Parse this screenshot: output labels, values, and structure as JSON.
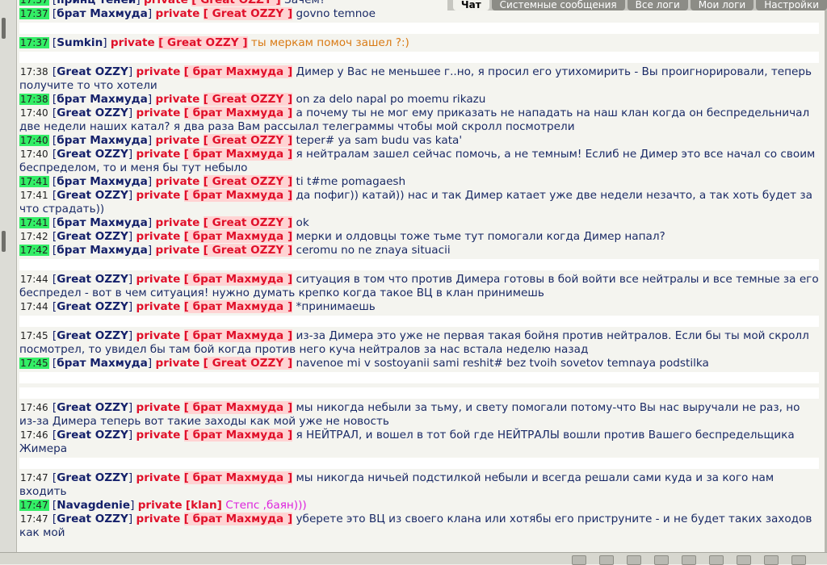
{
  "tabs": [
    "Чат",
    "Системные сообщения",
    "Все логи",
    "Мои логи",
    "Настройки"
  ],
  "messages": [
    {
      "time": "17:37",
      "time_hl": true,
      "name": "принц теней",
      "target": "Great OZZY",
      "text": "Зачем?"
    },
    {
      "time": "17:37",
      "time_hl": true,
      "name": "брат Махмуда",
      "target": "Great OZZY",
      "text": "govno temnoe"
    },
    {
      "blank": true
    },
    {
      "time": "17:37",
      "time_hl": true,
      "name": "Sumkin",
      "target": "Great OZZY",
      "text": "ты меркам помоч зашел ?:)",
      "color": "orange"
    },
    {
      "blank": true
    },
    {
      "time": "17:38",
      "time_hl": false,
      "name": "Great OZZY",
      "target": "брат Махмуда",
      "text": "Димер у Вас не меньшее г..но, я просил его утихомирить - Вы проигнорировали, теперь получите то что хотели"
    },
    {
      "time": "17:38",
      "time_hl": true,
      "name": "брат Махмуда",
      "target": "Great OZZY",
      "text": "on za delo napal po moemu rikazu"
    },
    {
      "time": "17:40",
      "time_hl": false,
      "name": "Great OZZY",
      "target": "брат Махмуда",
      "text": "а почему ты не мог ему приказать не нападать на наш клан когда он беспредельничал две недели наших катал? я два раза Вам рассылал телеграммы чтобы мой скролл посмотрели"
    },
    {
      "time": "17:40",
      "time_hl": true,
      "name": "брат Махмуда",
      "target": "Great OZZY",
      "text": "teper# ya sam budu vas kata'"
    },
    {
      "time": "17:40",
      "time_hl": false,
      "name": "Great OZZY",
      "target": "брат Махмуда",
      "text": "я нейтралам зашел сейчас помочь, а не темным! Еслиб не Димер это все начал со своим беспределом, то и меня бы тут небыло"
    },
    {
      "time": "17:41",
      "time_hl": true,
      "name": "брат Махмуда",
      "target": "Great OZZY",
      "text": "ti t#me pomagaesh"
    },
    {
      "time": "17:41",
      "time_hl": false,
      "name": "Great OZZY",
      "target": "брат Махмуда",
      "text": "да пофиг)) катай)) нас и так Димер катает уже две недели незачто, а так хоть будет за что страдать))"
    },
    {
      "time": "17:41",
      "time_hl": true,
      "name": "брат Махмуда",
      "target": "Great OZZY",
      "text": "ok"
    },
    {
      "time": "17:42",
      "time_hl": false,
      "name": "Great OZZY",
      "target": "брат Махмуда",
      "text": "мерки и олдовцы тоже тьме тут помогали когда Димер напал?"
    },
    {
      "time": "17:42",
      "time_hl": true,
      "name": "брат Махмуда",
      "target": "Great OZZY",
      "text": "ceromu no ne znaya situacii"
    },
    {
      "blank": true
    },
    {
      "time": "17:44",
      "time_hl": false,
      "name": "Great OZZY",
      "target": "брат Махмуда",
      "text": "ситуация в том что против Димера готовы в бой войти все нейтралы и все темные за его беспредел - вот в чем ситуация! нужно думать крепко когда такое ВЦ в клан принимешь"
    },
    {
      "time": "17:44",
      "time_hl": false,
      "name": "Great OZZY",
      "target": "брат Махмуда",
      "text": "*принимаешь"
    },
    {
      "blank": true
    },
    {
      "time": "17:45",
      "time_hl": false,
      "name": "Great OZZY",
      "target": "брат Махмуда",
      "text": "из-за Димера это уже не первая такая бойня против нейтралов. Если бы ты мой скролл посмотрел, то увидел бы там бой когда против него куча нейтралов за нас встала неделю назад"
    },
    {
      "time": "17:45",
      "time_hl": true,
      "name": "брат Махмуда",
      "target": "Great OZZY",
      "text": "navenoe mi v sostoyanii sami reshit# bez tvoih sovetov temnaya podstilka"
    },
    {
      "blank": true
    },
    {
      "blank": true
    },
    {
      "time": "17:46",
      "time_hl": false,
      "name": "Great OZZY",
      "target": "брат Махмуда",
      "text": "мы никогда небыли за тьму, и свету помогали потому-что Вы нас выручали не раз, но из-за Димера теперь вот такие заходы как мой уже не новость"
    },
    {
      "time": "17:46",
      "time_hl": false,
      "name": "Great OZZY",
      "target": "брат Махмуда",
      "text": "я НЕЙТРАЛ, и вошел в тот бой где НЕЙТРАЛЫ вошли против Вашего беспредельщика Жимера"
    },
    {
      "blank": true
    },
    {
      "time": "17:47",
      "time_hl": false,
      "name": "Great OZZY",
      "target": "брат Махмуда",
      "text": "мы никогда ничьей подстилкой небыли и всегда решали сами куда и за кого нам входить"
    },
    {
      "time": "17:47",
      "time_hl": true,
      "name": "Navagdenie",
      "target": "klan",
      "text": "Степс ,баян)))",
      "color": "pink",
      "plain_target": true
    },
    {
      "time": "17:47",
      "time_hl": false,
      "name": "Great OZZY",
      "target": "брат Махмуда",
      "text": "уберете это ВЦ из своего клана или хотябы его приструните - и не будет таких заходов как мой"
    }
  ],
  "labels": {
    "private": "private"
  }
}
